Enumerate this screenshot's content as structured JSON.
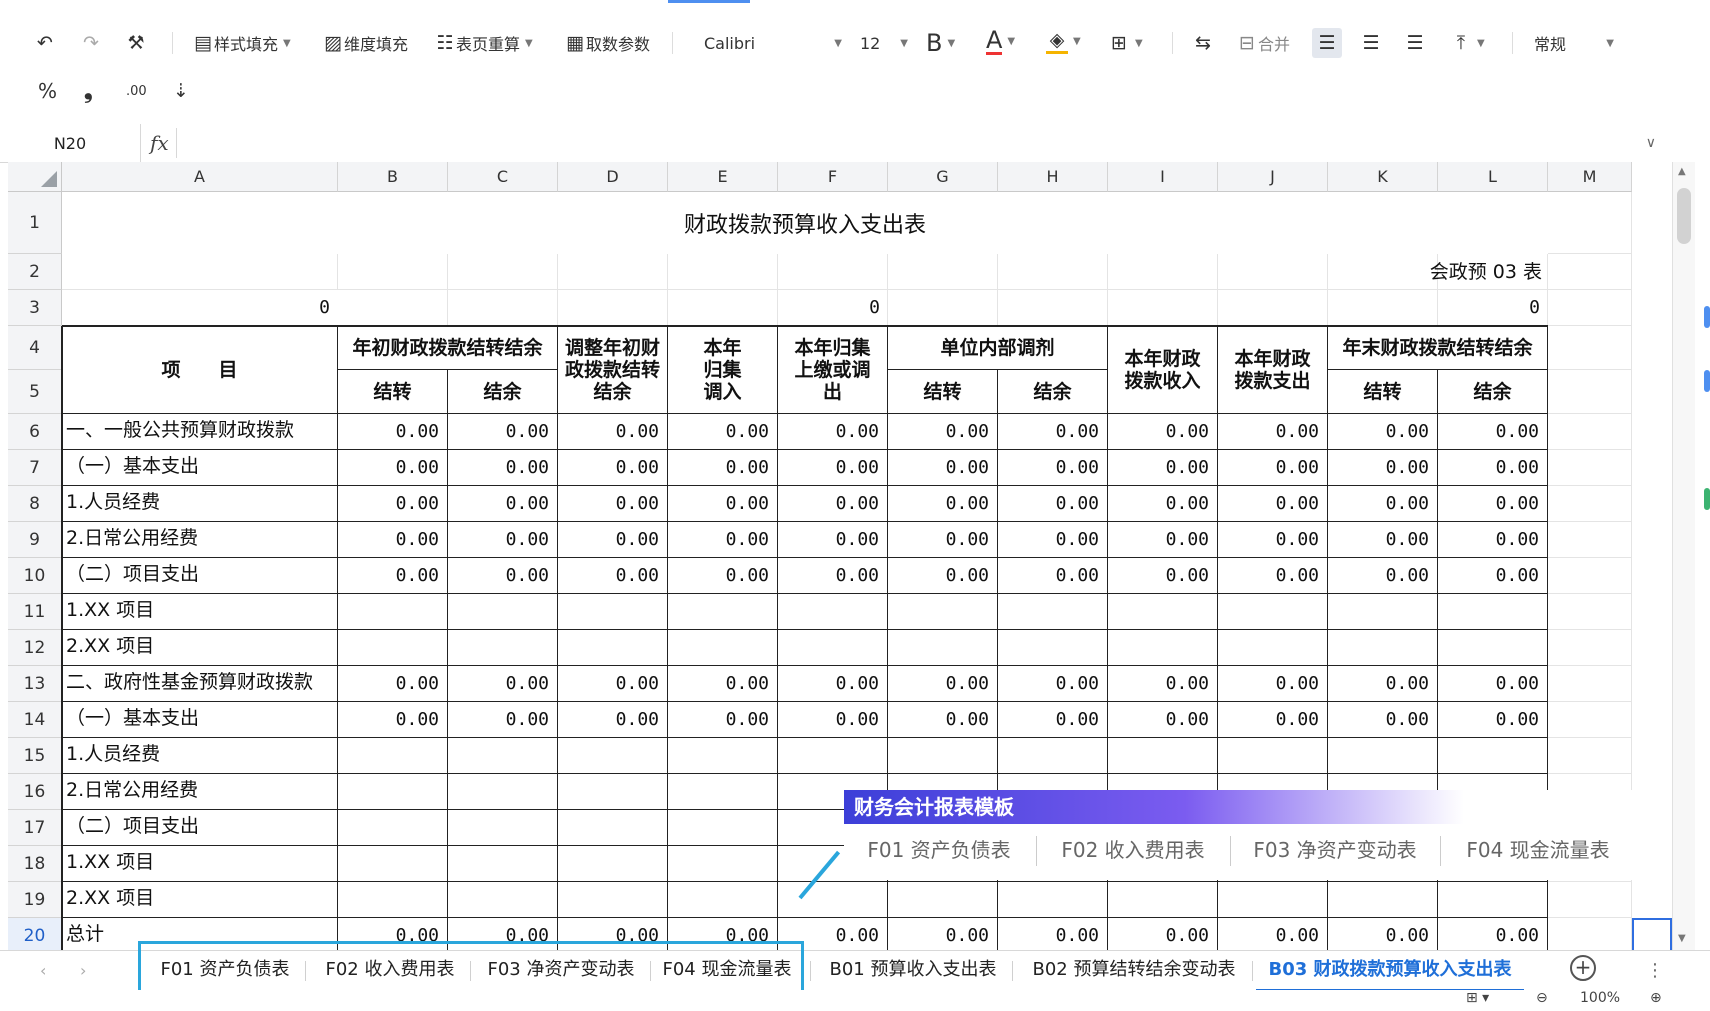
{
  "toolbar": {
    "undo_icon": "undo-icon",
    "redo_icon": "redo-icon",
    "style_fill": "样式填充",
    "dim_fill": "维度填充",
    "recalc": "表页重算",
    "fetch_params": "取数参数",
    "font_name": "Calibri",
    "font_size": "12",
    "bold": "B",
    "font_color_letter": "A",
    "merge": "合并",
    "number_format": "常规",
    "percent": "%",
    "comma": "❟",
    "inc_decimal": ".00"
  },
  "formula_bar": {
    "name_box": "N20",
    "fx": "fx",
    "formula": ""
  },
  "columns": [
    "A",
    "B",
    "C",
    "D",
    "E",
    "F",
    "G",
    "H",
    "I",
    "J",
    "K",
    "L",
    "M"
  ],
  "rows": [
    "1",
    "2",
    "3",
    "4",
    "5",
    "6",
    "7",
    "8",
    "9",
    "10",
    "11",
    "12",
    "13",
    "14",
    "15",
    "16",
    "17",
    "18",
    "19",
    "20"
  ],
  "sheet": {
    "title": "财政拨款预算收入支出表",
    "form_code": "会政预 03 表",
    "row3": {
      "a": "0",
      "f": "0",
      "l": "0"
    },
    "headers": {
      "item": "项　　目",
      "opening_balance": "年初财政拨款结转结余",
      "adjust": "调整年初财政拨款结转结余",
      "collected_in": "本年归集调入",
      "collected_out": "本年归集上缴或调出",
      "internal_adjust": "单位内部调剂",
      "income": "本年财政拨款收入",
      "expense": "本年财政拨款支出",
      "closing_balance": "年末财政拨款结转结余",
      "carry": "结转",
      "surplus": "结余"
    },
    "body": [
      {
        "label": "一、一般公共预算财政拨款",
        "values": [
          "0.00",
          "0.00",
          "0.00",
          "0.00",
          "0.00",
          "0.00",
          "0.00",
          "0.00",
          "0.00",
          "0.00",
          "0.00"
        ]
      },
      {
        "label": "（一）基本支出",
        "values": [
          "0.00",
          "0.00",
          "0.00",
          "0.00",
          "0.00",
          "0.00",
          "0.00",
          "0.00",
          "0.00",
          "0.00",
          "0.00"
        ]
      },
      {
        "label": "1.人员经费",
        "values": [
          "0.00",
          "0.00",
          "0.00",
          "0.00",
          "0.00",
          "0.00",
          "0.00",
          "0.00",
          "0.00",
          "0.00",
          "0.00"
        ]
      },
      {
        "label": "2.日常公用经费",
        "values": [
          "0.00",
          "0.00",
          "0.00",
          "0.00",
          "0.00",
          "0.00",
          "0.00",
          "0.00",
          "0.00",
          "0.00",
          "0.00"
        ]
      },
      {
        "label": "（二）项目支出",
        "values": [
          "0.00",
          "0.00",
          "0.00",
          "0.00",
          "0.00",
          "0.00",
          "0.00",
          "0.00",
          "0.00",
          "0.00",
          "0.00"
        ]
      },
      {
        "label": "1.XX 项目",
        "values": [
          "",
          "",
          "",
          "",
          "",
          "",
          "",
          "",
          "",
          "",
          ""
        ]
      },
      {
        "label": "2.XX 项目",
        "values": [
          "",
          "",
          "",
          "",
          "",
          "",
          "",
          "",
          "",
          "",
          ""
        ]
      },
      {
        "label": "二、政府性基金预算财政拨款",
        "values": [
          "0.00",
          "0.00",
          "0.00",
          "0.00",
          "0.00",
          "0.00",
          "0.00",
          "0.00",
          "0.00",
          "0.00",
          "0.00"
        ]
      },
      {
        "label": "（一）基本支出",
        "values": [
          "0.00",
          "0.00",
          "0.00",
          "0.00",
          "0.00",
          "0.00",
          "0.00",
          "0.00",
          "0.00",
          "0.00",
          "0.00"
        ]
      },
      {
        "label": "1.人员经费",
        "values": [
          "",
          "",
          "",
          "",
          "",
          "",
          "",
          "",
          "",
          "",
          ""
        ]
      },
      {
        "label": "2.日常公用经费",
        "values": [
          "",
          "",
          "",
          "",
          "",
          "",
          "",
          "",
          "",
          "",
          ""
        ]
      },
      {
        "label": "（二）项目支出",
        "values": [
          "",
          "",
          "",
          "",
          "",
          "",
          "",
          "",
          "",
          "",
          ""
        ]
      },
      {
        "label": "1.XX 项目",
        "values": [
          "",
          "",
          "",
          "",
          "",
          "",
          "",
          "",
          "",
          "",
          ""
        ]
      },
      {
        "label": "2.XX 项目",
        "values": [
          "",
          "",
          "",
          "",
          "",
          "",
          "",
          "",
          "",
          "",
          ""
        ]
      },
      {
        "label": "总计",
        "values": [
          "0.00",
          "0.00",
          "0.00",
          "0.00",
          "0.00",
          "0.00",
          "0.00",
          "0.00",
          "0.00",
          "0.00",
          "0.00"
        ]
      }
    ]
  },
  "overlay": {
    "title": "财务会计报表模板",
    "tabs": [
      "F01 资产负债表",
      "F02 收入费用表",
      "F03 净资产变动表",
      "F04 现金流量表"
    ]
  },
  "sheet_tabs": [
    "F01 资产负债表",
    "F02 收入费用表",
    "F03 净资产变动表",
    "F04 现金流量表",
    "B01 预算收入支出表",
    "B02 预算结转结余变动表",
    "B03 财政拨款预算收入支出表"
  ],
  "active_tab_index": 6,
  "status": {
    "zoom": "100%"
  },
  "colors": {
    "accent": "#1f6fd8",
    "highlight": "#2aa6dc",
    "overlay_gradient_start": "#3c3fd8"
  }
}
